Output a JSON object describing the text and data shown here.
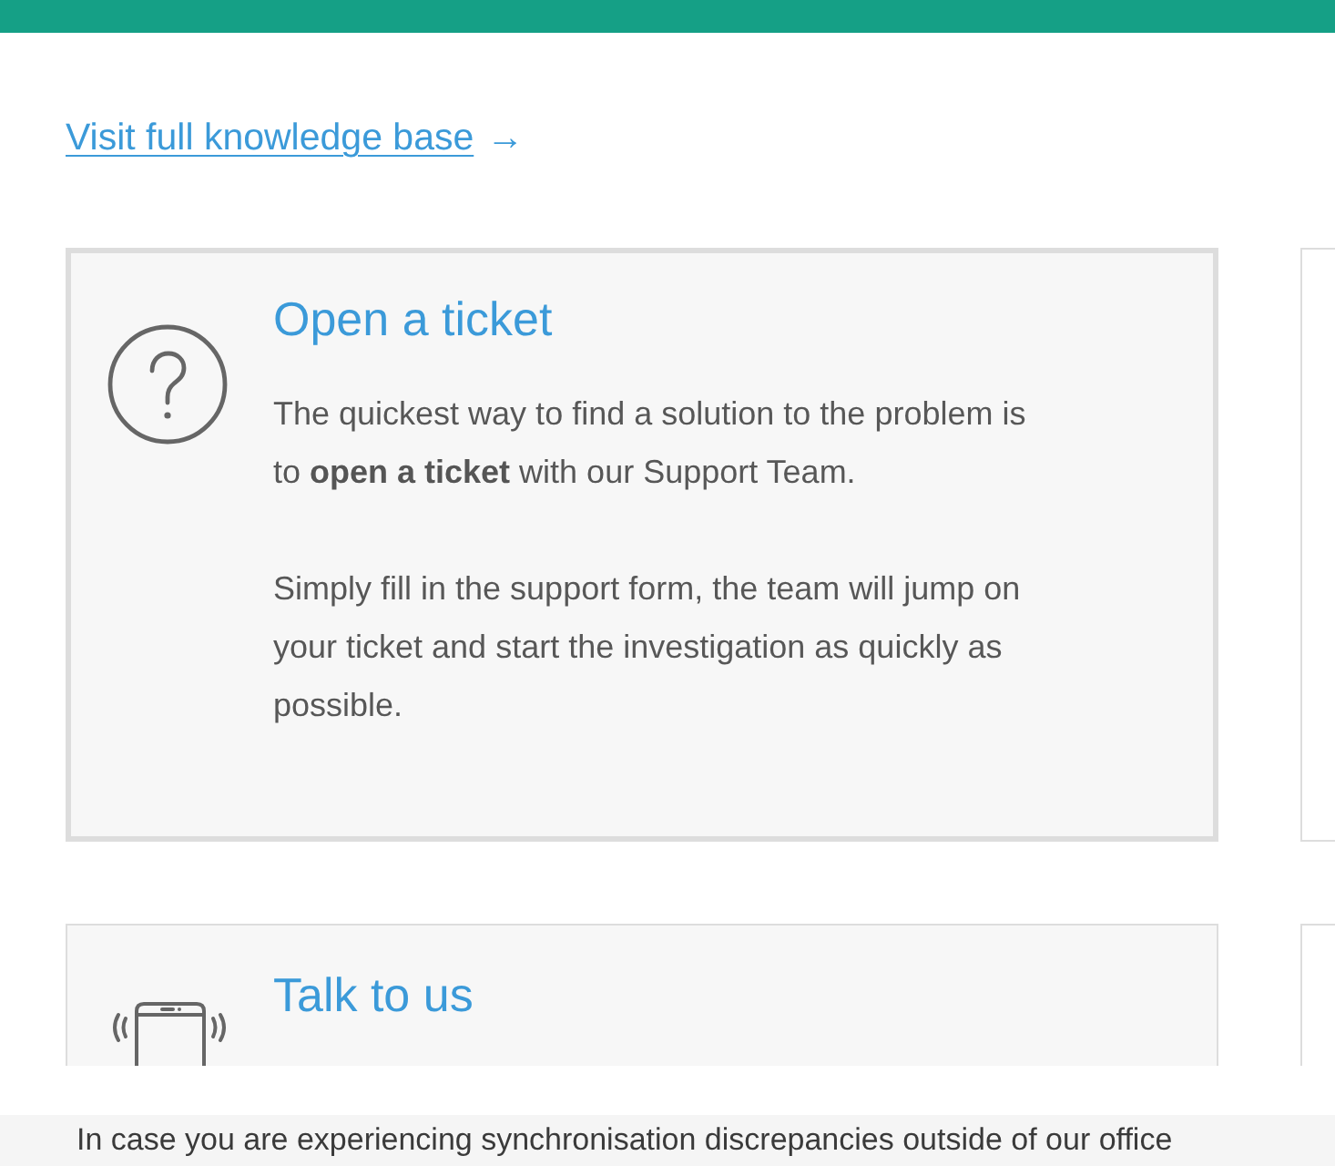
{
  "knowledge_link": {
    "label": "Visit full knowledge base",
    "arrow": "→"
  },
  "cards": [
    {
      "kind": "question",
      "highlighted": true,
      "title": "Open a ticket",
      "paragraphs": [
        "The quickest way to find a solution to the problem is to **open a ticket** with our Support Team.",
        "Simply fill in the support form, the team will jump on your ticket and start the investigation as quickly as possible."
      ]
    },
    {
      "kind": "phone",
      "highlighted": false,
      "title": "Talk to us"
    }
  ],
  "notice": {
    "text": "In case you are experiencing synchronisation discrepancies outside of our office"
  }
}
